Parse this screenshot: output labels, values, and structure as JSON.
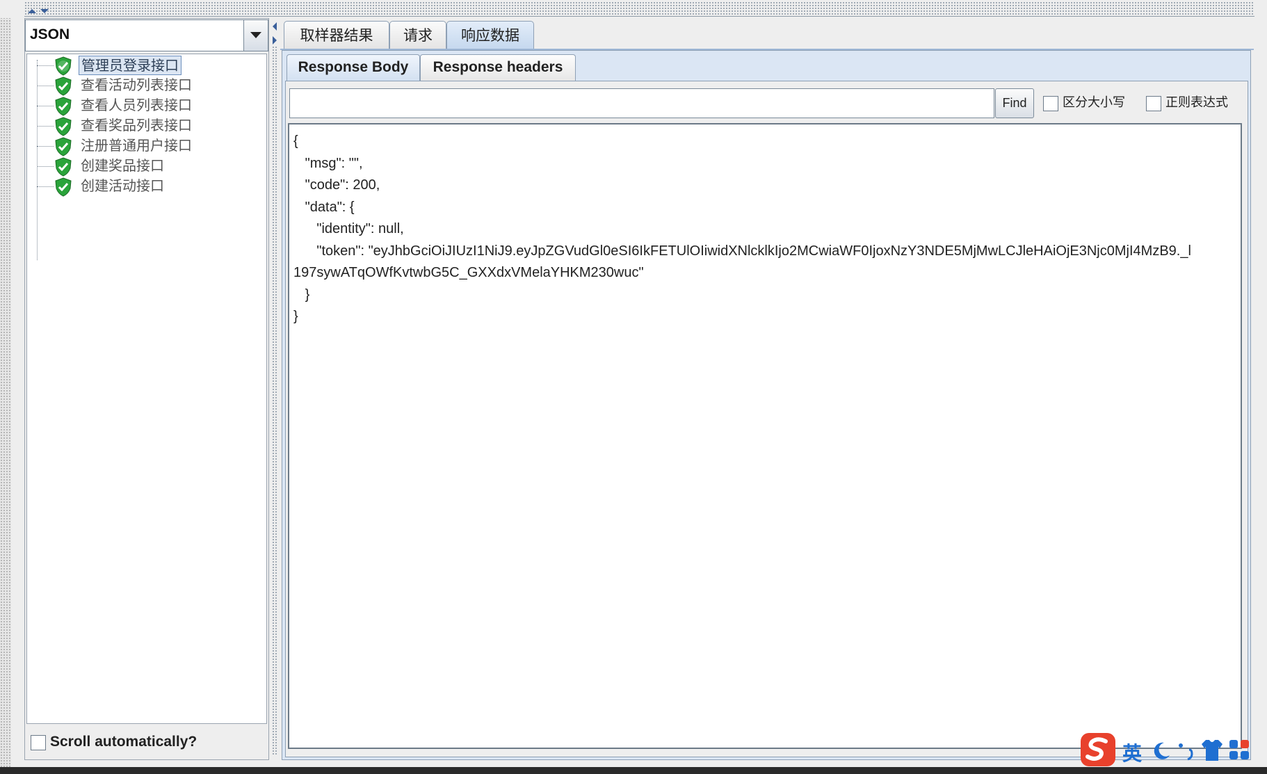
{
  "left_panel": {
    "format_select": {
      "value": "JSON"
    },
    "tree_items": [
      {
        "label": "管理员登录接口",
        "status": "success"
      },
      {
        "label": "查看活动列表接口",
        "status": "success"
      },
      {
        "label": "查看人员列表接口",
        "status": "success"
      },
      {
        "label": "查看奖品列表接口",
        "status": "success"
      },
      {
        "label": "注册普通用户接口",
        "status": "success"
      },
      {
        "label": "创建奖品接口",
        "status": "success"
      },
      {
        "label": "创建活动接口",
        "status": "success"
      }
    ],
    "scroll_auto_label": "Scroll automatically?"
  },
  "main_tabs": [
    {
      "label": "取样器结果"
    },
    {
      "label": "请求"
    },
    {
      "label": "响应数据",
      "active": true
    }
  ],
  "sub_tabs": [
    {
      "label": "Response Body",
      "active": true
    },
    {
      "label": "Response headers"
    }
  ],
  "search": {
    "value": "",
    "find_label": "Find",
    "case_sensitive_label": "区分大小写",
    "regex_label": "正则表达式"
  },
  "response_body_lines": [
    "{",
    "   \"msg\": \"\",",
    "   \"code\": 200,",
    "   \"data\": {",
    "      \"identity\": null,",
    "      \"token\": \"eyJhbGciOiJIUzI1NiJ9.eyJpZGVudGl0eSI6IkFETUlOIiwidXNlcklkIjo2MCwiaWF0IjoxNzY3NDE5MjMwLCJleHAiOjE3Njc0MjI4MzB9._l",
    "197sywATqOWfKvtwbG5C_GXXdxVMelaYHKM230wuc\"",
    "   }",
    "}"
  ],
  "ime_tray": {
    "lang_label": "英",
    "colors": {
      "logo": "#e8412c",
      "icons": "#1f6fd1"
    }
  },
  "colors": {
    "success": "#2aa33a",
    "selection": "#dce6f3",
    "tab_active": "#c4d7ee"
  }
}
